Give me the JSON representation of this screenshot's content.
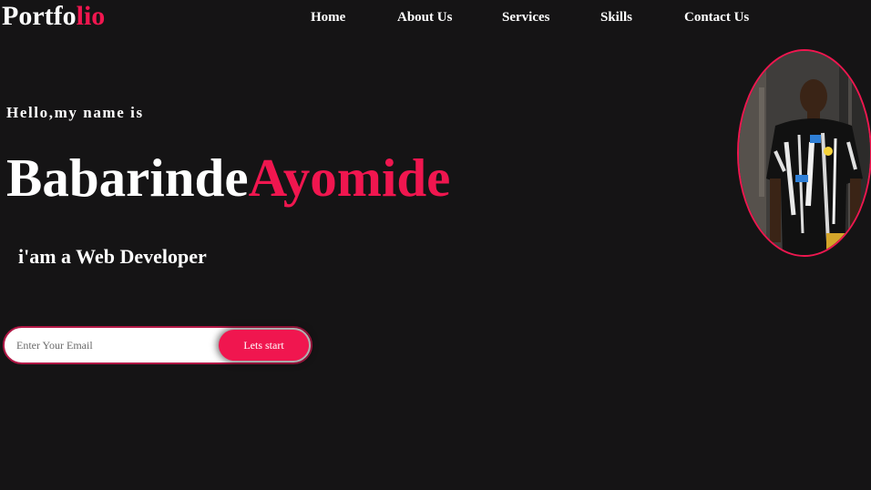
{
  "brand": {
    "logo_main": "Portfo",
    "logo_accent": "lio",
    "accent_color": "#f0164f",
    "background_color": "#151415"
  },
  "nav": {
    "items": [
      {
        "label": "Home"
      },
      {
        "label": "About Us"
      },
      {
        "label": "Services"
      },
      {
        "label": "Skills"
      },
      {
        "label": "Contact Us"
      }
    ]
  },
  "hero": {
    "greeting": "Hello,my name is",
    "first_name": "Babarinde",
    "last_name": "Ayomide",
    "role": "i'am a Web Developer",
    "email_placeholder": "Enter Your Email",
    "email_value": "",
    "cta_label": "Lets start",
    "photo_icon": "profile-photo"
  }
}
